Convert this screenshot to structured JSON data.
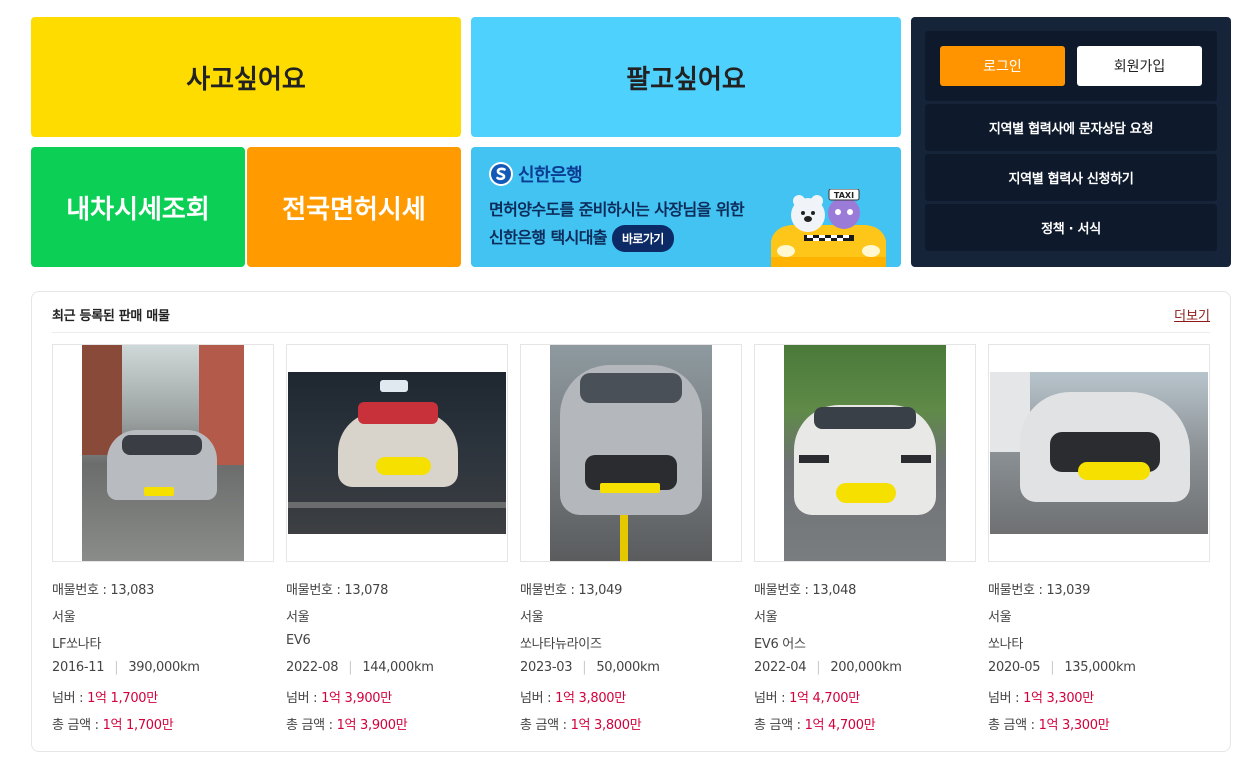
{
  "tiles": {
    "buy": "사고싶어요",
    "sell": "팔고싶어요",
    "my_car_price": "내차시세조회",
    "license_price": "전국면허시세"
  },
  "banner": {
    "bank_name": "신한은행",
    "line1": "면허양수도를 준비하시는 사장님을 위한",
    "line2": "신한은행 택시대출",
    "button": "바로가기",
    "taxi_sign": "TAXI"
  },
  "side": {
    "login": "로그인",
    "signup": "회원가입",
    "links": [
      "지역별 협력사에 문자상담 요청",
      "지역별 협력사 신청하기",
      "정책 · 서식"
    ]
  },
  "listing": {
    "title": "최근 등록된 판매 매물",
    "more": "더보기",
    "items": [
      {
        "id_label": "매물번호 : 13,083",
        "region": "서울",
        "model": "LF쏘나타",
        "date": "2016-11",
        "mileage": "390,000km",
        "number_label": "넘버 : ",
        "number_price": "1억 1,700만",
        "total_label": "총 금액 : ",
        "total_price": "1억 1,700만"
      },
      {
        "id_label": "매물번호 : 13,078",
        "region": "서울",
        "model": "EV6",
        "date": "2022-08",
        "mileage": "144,000km",
        "number_label": "넘버 : ",
        "number_price": "1억 3,900만",
        "total_label": "총 금액 : ",
        "total_price": "1억 3,900만"
      },
      {
        "id_label": "매물번호 : 13,049",
        "region": "서울",
        "model": "쏘나타뉴라이즈",
        "date": "2023-03",
        "mileage": "50,000km",
        "number_label": "넘버 : ",
        "number_price": "1억 3,800만",
        "total_label": "총 금액 : ",
        "total_price": "1억 3,800만"
      },
      {
        "id_label": "매물번호 : 13,048",
        "region": "서울",
        "model": "EV6 어스",
        "date": "2022-04",
        "mileage": "200,000km",
        "number_label": "넘버 : ",
        "number_price": "1억 4,700만",
        "total_label": "총 금액 : ",
        "total_price": "1억 4,700만"
      },
      {
        "id_label": "매물번호 : 13,039",
        "region": "서울",
        "model": "쏘나타",
        "date": "2020-05",
        "mileage": "135,000km",
        "number_label": "넘버 : ",
        "number_price": "1억 3,300만",
        "total_label": "총 금액 : ",
        "total_price": "1억 3,300만"
      }
    ]
  },
  "colors": {
    "buy": "#ffdc00",
    "sell": "#4fd1fd",
    "my_car": "#0ccf55",
    "license": "#ff9a00",
    "banner": "#42c3f2",
    "panel": "#16243a",
    "login": "#ff9400",
    "price": "#d4003c"
  }
}
